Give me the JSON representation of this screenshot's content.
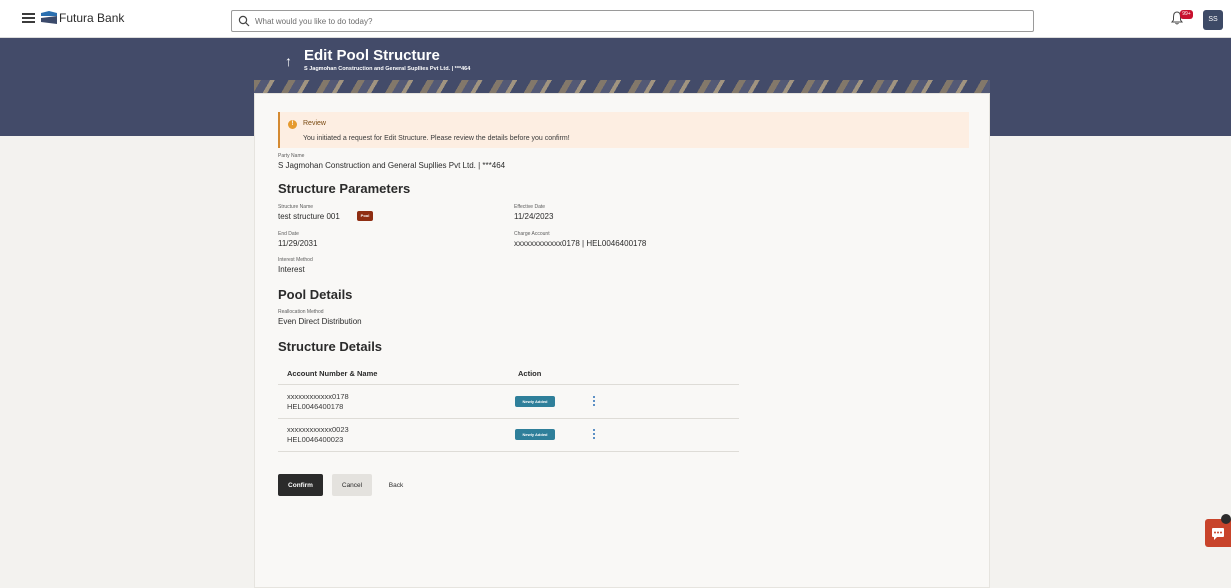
{
  "header": {
    "brand": "Futura Bank",
    "search_placeholder": "What would you like to do today?",
    "notification_count": "99+",
    "user_initials": "SS"
  },
  "banner": {
    "title": "Edit Pool Structure",
    "subtitle": "S Jagmohan Construction and General Supllies Pvt Ltd. | ***464"
  },
  "review": {
    "title": "Review",
    "message": "You initiated a request for Edit Structure. Please review the details before you confirm!"
  },
  "party": {
    "label": "Party Name",
    "value": "S Jagmohan Construction and General Supllies Pvt Ltd. | ***464"
  },
  "structure_parameters": {
    "heading": "Structure Parameters",
    "structure_name_label": "Structure Name",
    "structure_name": "test structure 001",
    "structure_type_badge": "Pool",
    "effective_date_label": "Effective Date",
    "effective_date": "11/24/2023",
    "end_date_label": "End Date",
    "end_date": "11/29/2031",
    "charge_account_label": "Charge Account",
    "charge_account": "xxxxxxxxxxxx0178 | HEL0046400178",
    "interest_method_label": "Interest Method",
    "interest_method": "Interest"
  },
  "pool_details": {
    "heading": "Pool Details",
    "reallocation_label": "Reallocation Method",
    "reallocation_value": "Even Direct Distribution"
  },
  "structure_details": {
    "heading": "Structure Details",
    "col_account": "Account Number & Name",
    "col_action": "Action",
    "rows": [
      {
        "account": "xxxxxxxxxxxx0178",
        "name": "HEL0046400178",
        "status": "Newly Added"
      },
      {
        "account": "xxxxxxxxxxxx0023",
        "name": "HEL0046400023",
        "status": "Newly Added"
      }
    ]
  },
  "actions": {
    "confirm": "Confirm",
    "cancel": "Cancel",
    "back": "Back"
  },
  "colors": {
    "banner": "#434b69",
    "confirm_button": "#2b2b2b",
    "pool_badge": "#8f2e12",
    "status_tag": "#2f7f9a",
    "review_bg": "#fdeee2"
  }
}
